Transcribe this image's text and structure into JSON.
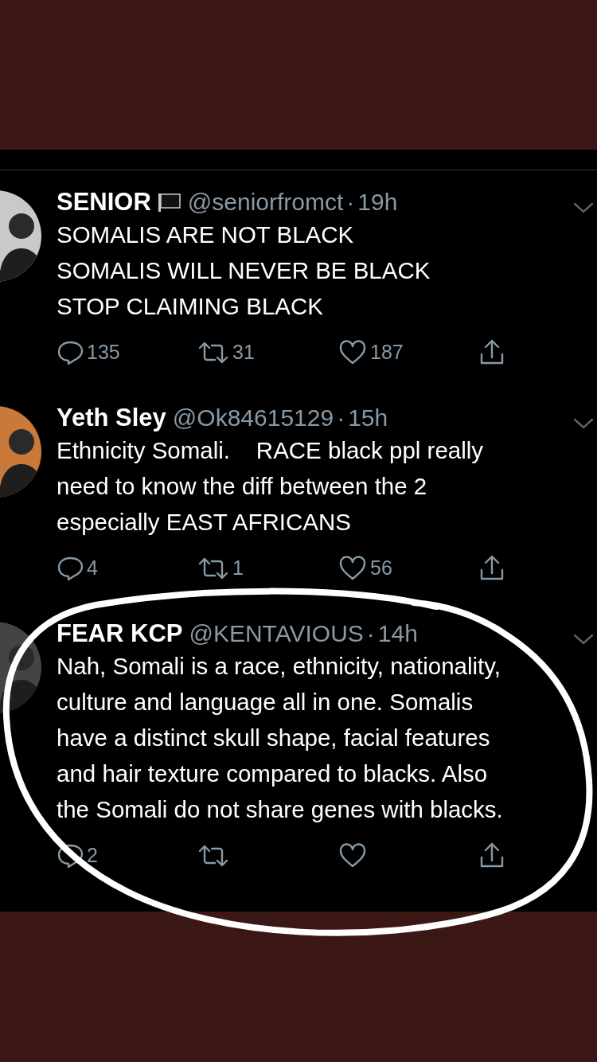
{
  "tweets": [
    {
      "name": "SENIOR",
      "flag": true,
      "handle": "@seniorfromct",
      "separator": "·",
      "time": "19h",
      "text": "SOMALIS ARE NOT BLACK\nSOMALIS WILL NEVER BE BLACK\nSTOP CLAIMING BLACK",
      "replies": "135",
      "retweets": "31",
      "likes": "187"
    },
    {
      "name": "Yeth Sley",
      "flag": false,
      "handle": "@Ok84615129",
      "separator": "·",
      "time": "15h",
      "text": "Ethnicity Somali.    RACE black ppl really\nneed to know the diff between the 2\nespecially EAST AFRICANS",
      "replies": "4",
      "retweets": "1",
      "likes": "56"
    },
    {
      "name": "FEAR KCP",
      "flag": false,
      "handle": "@KENTAVIOUS",
      "separator": "·",
      "time": "14h",
      "text": "Nah, Somali is a race, ethnicity, nationality,\nculture and language all in one. Somalis\nhave a distinct skull shape, facial features\nand hair texture compared to blacks. Also\nthe Somali do not share genes with blacks.",
      "replies": "2"
    }
  ]
}
